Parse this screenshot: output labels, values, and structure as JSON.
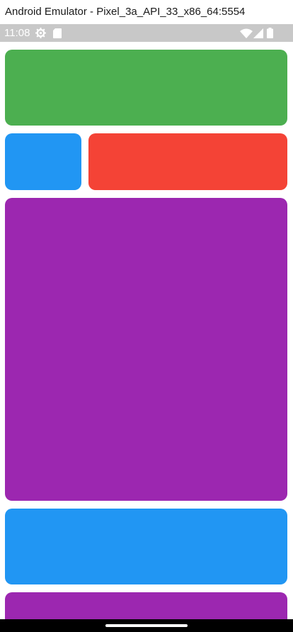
{
  "window": {
    "title": "Android Emulator - Pixel_3a_API_33_x86_64:5554"
  },
  "status_bar": {
    "time": "11:08",
    "left_icons": [
      "settings-gear-icon",
      "sd-card-icon"
    ],
    "right_icons": [
      "wifi-icon",
      "cell-signal-icon",
      "battery-icon"
    ]
  },
  "tiles": [
    {
      "name": "green-tile",
      "color": "#4caf50"
    },
    {
      "name": "blue-small-tile",
      "color": "#2196f3"
    },
    {
      "name": "red-tile",
      "color": "#f44336"
    },
    {
      "name": "purple-large-tile",
      "color": "#9c27b0"
    },
    {
      "name": "blue-wide-tile",
      "color": "#2196f3"
    },
    {
      "name": "purple-bottom-tile",
      "color": "#9c27b0"
    }
  ]
}
